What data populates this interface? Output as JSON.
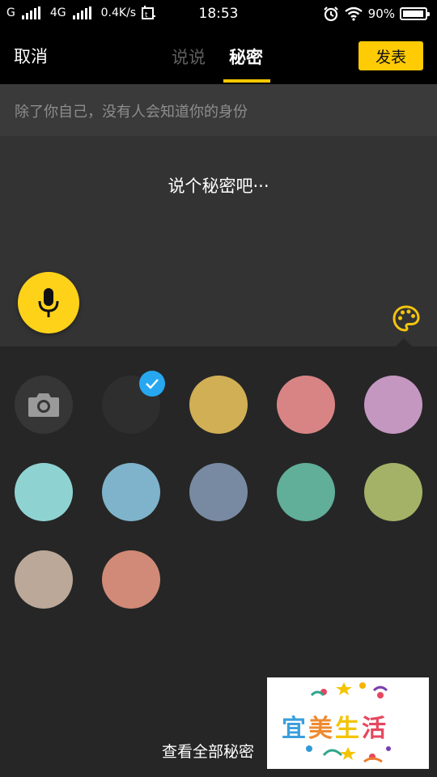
{
  "status_bar": {
    "carrier1": "G",
    "carrier2": "4G",
    "speed": "0.4K/s",
    "time": "18:53",
    "battery": "90%"
  },
  "header": {
    "cancel_label": "取消",
    "tabs": [
      {
        "label": "说说",
        "active": false
      },
      {
        "label": "秘密",
        "active": true
      }
    ],
    "publish_label": "发表"
  },
  "hint": "除了你自己，没有人会知道你的身份",
  "editor": {
    "prompt": "说个秘密吧···"
  },
  "colors": {
    "accent": "#ffcb05",
    "check": "#27a7f0",
    "swatches": [
      "camera",
      "#2e2e2e",
      "#d1af55",
      "#d98484",
      "#c497c1",
      "#8ed3d2",
      "#7fb3cb",
      "#788aa1",
      "#61ae99",
      "#a4b267",
      "#bba898",
      "#d18a77"
    ],
    "selected_index": 1
  },
  "bottom": {
    "view_all_label": "查看全部秘密"
  },
  "watermark": {
    "text": "宜美生活"
  }
}
